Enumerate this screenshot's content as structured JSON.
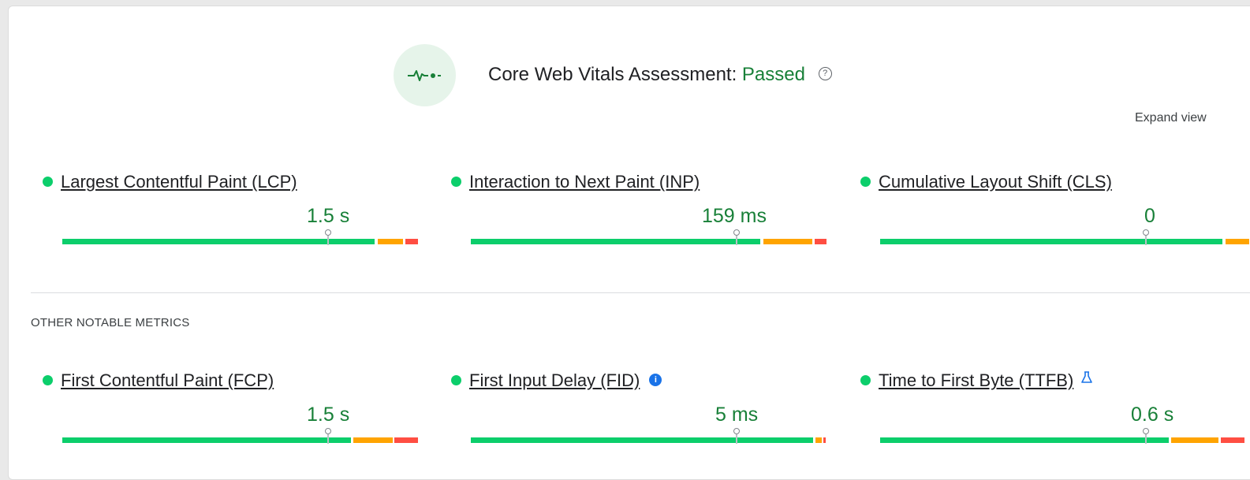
{
  "assessment": {
    "title": "Core Web Vitals Assessment:",
    "status": "Passed",
    "status_color": "#188038",
    "icon": "pulse-icon",
    "help_icon": "help-circle-icon"
  },
  "expand_view": "Expand view",
  "core_metrics": [
    {
      "name": "Largest Contentful Paint (LCP)",
      "value": "1.5 s",
      "rating": "good"
    },
    {
      "name": "Interaction to Next Paint (INP)",
      "value": "159 ms",
      "rating": "good"
    },
    {
      "name": "Cumulative Layout Shift (CLS)",
      "value": "0",
      "rating": "good"
    }
  ],
  "other_section_label": "OTHER NOTABLE METRICS",
  "other_metrics": [
    {
      "name": "First Contentful Paint (FCP)",
      "value": "1.5 s",
      "rating": "good"
    },
    {
      "name": "First Input Delay (FID)",
      "value": "5 ms",
      "rating": "good",
      "badge_icon": "info-icon"
    },
    {
      "name": "Time to First Byte (TTFB)",
      "value": "0.6 s",
      "rating": "good",
      "badge_icon": "flask-icon"
    }
  ],
  "colors": {
    "good": "#0cce6b",
    "needs_improvement": "#ffa400",
    "poor": "#ff4e42",
    "accent": "#1a73e8"
  }
}
